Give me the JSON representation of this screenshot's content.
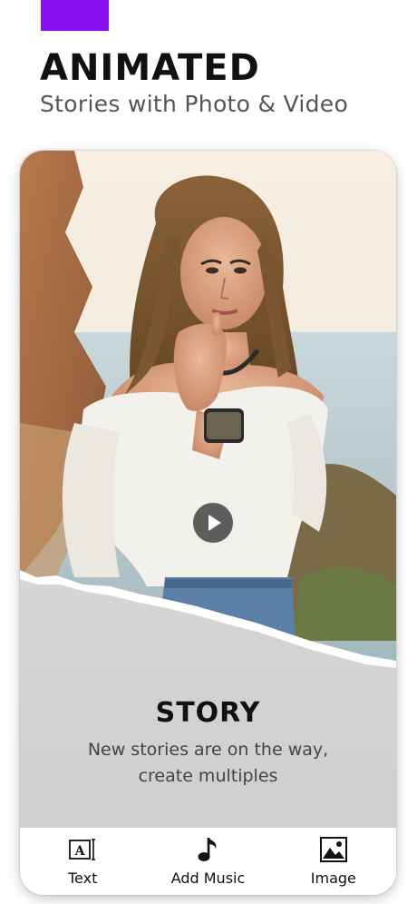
{
  "header": {
    "accent_color": "#8a10f2",
    "title": "ANIMATED",
    "subtitle": "Stories with Photo & Video"
  },
  "story": {
    "title": "STORY",
    "description_line1": "New stories are on the way,",
    "description_line2": "create multiples"
  },
  "toolbar": {
    "items": [
      {
        "label": "Text",
        "icon": "text-format-icon"
      },
      {
        "label": "Add Music",
        "icon": "music-note-icon"
      },
      {
        "label": "Image",
        "icon": "image-icon"
      }
    ]
  }
}
